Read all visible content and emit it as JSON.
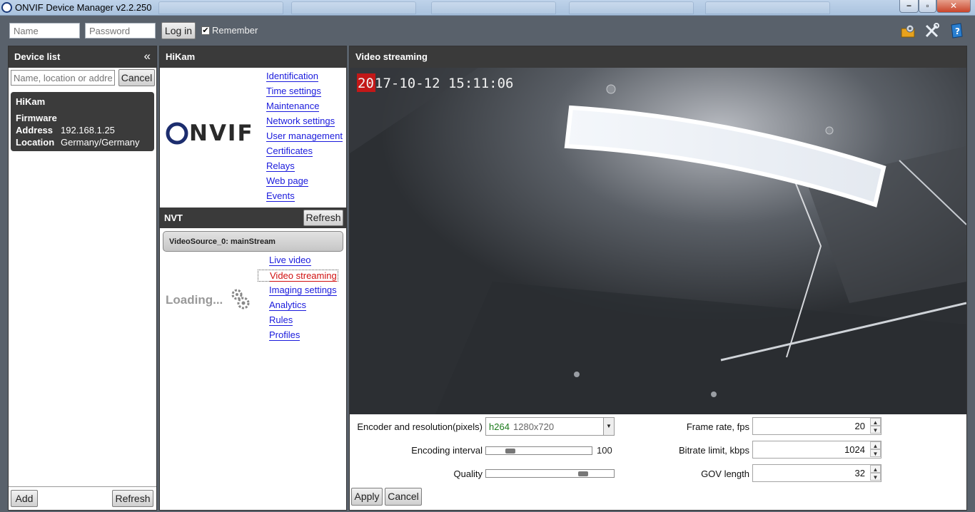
{
  "window": {
    "title": "ONVIF Device Manager v2.2.250",
    "minimize": "−",
    "maximize": "▫",
    "close": "✕"
  },
  "login": {
    "name_placeholder": "Name",
    "password_placeholder": "Password",
    "login_label": "Log in",
    "remember_label": "Remember",
    "remember_checked": "✔"
  },
  "toolbar_icons": [
    "settings-gear-icon",
    "tools-icon",
    "help-book-icon"
  ],
  "device_list": {
    "title": "Device list",
    "collapse_glyph": "«",
    "search_placeholder": "Name, location or address",
    "cancel_label": "Cancel",
    "devices": [
      {
        "name": "HiKam",
        "firmware_label": "Firmware",
        "address_label": "Address",
        "address": "192.168.1.25",
        "location_label": "Location",
        "location": "Germany/Germany"
      }
    ],
    "add_label": "Add",
    "refresh_label": "Refresh"
  },
  "device_panel": {
    "title": "HiKam",
    "logo_text": "NVIF",
    "links": [
      "Identification",
      "Time settings",
      "Maintenance",
      "Network settings",
      "User management",
      "Certificates",
      "Relays",
      "Web page",
      "Events"
    ],
    "nvt_title": "NVT",
    "nvt_refresh": "Refresh",
    "source_label": "VideoSource_0: mainStream",
    "loading_text": "Loading...",
    "source_links": [
      "Live video",
      "Video streaming",
      "Imaging settings",
      "Analytics",
      "Rules",
      "Profiles"
    ],
    "active_link": "Video streaming"
  },
  "video": {
    "title": "Video streaming",
    "osd_prefix": "20",
    "osd_text": "17-10-12 15:11:06",
    "encoder_label": "Encoder and resolution(pixels)",
    "encoder_codec": "h264",
    "encoder_resolution": "1280x720",
    "encoding_interval_label": "Encoding interval",
    "encoding_interval_value": "100",
    "encoding_interval_fraction": 0.2,
    "quality_label": "Quality",
    "quality_fraction": 0.78,
    "frame_rate_label": "Frame rate, fps",
    "frame_rate_value": "20",
    "bitrate_label": "Bitrate limit, kbps",
    "bitrate_value": "1024",
    "gov_label": "GOV length",
    "gov_value": "32",
    "apply_label": "Apply",
    "cancel_label": "Cancel"
  },
  "colors": {
    "panel_header": "#3a3a3a",
    "link": "#1a1adc",
    "active_link": "#d01010",
    "codec_text": "#1a7a1a"
  }
}
